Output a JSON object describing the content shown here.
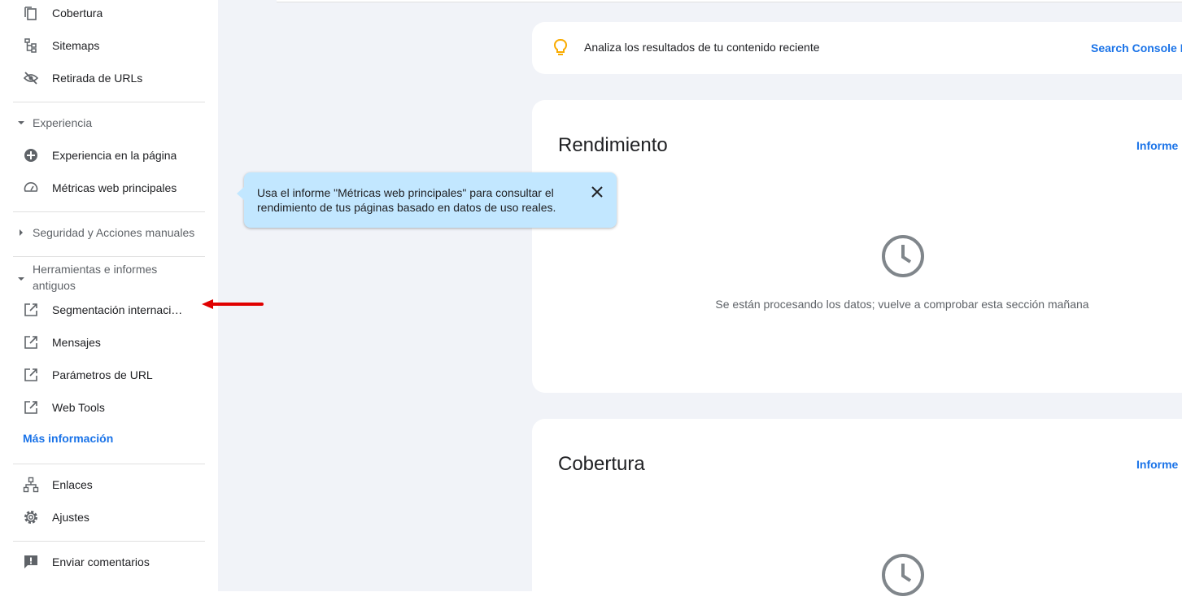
{
  "sidebar": {
    "top_items": [
      {
        "label": "Cobertura",
        "icon": "copy-pages-icon"
      },
      {
        "label": "Sitemaps",
        "icon": "sitemap-icon"
      },
      {
        "label": "Retirada de URLs",
        "icon": "eye-off-icon"
      }
    ],
    "experience": {
      "header": "Experiencia",
      "items": [
        {
          "label": "Experiencia en la página",
          "icon": "plus-circle-icon"
        },
        {
          "label": "Métricas web principales",
          "icon": "gauge-icon"
        }
      ]
    },
    "security": {
      "header": "Seguridad y Acciones manuales"
    },
    "legacy": {
      "header_line1": "Herramientas e informes",
      "header_line2": "antiguos",
      "items": [
        {
          "label": "Segmentación internaci…",
          "icon": "external-link-icon"
        },
        {
          "label": "Mensajes",
          "icon": "external-link-icon"
        },
        {
          "label": "Parámetros de URL",
          "icon": "external-link-icon"
        },
        {
          "label": "Web Tools",
          "icon": "external-link-icon"
        }
      ],
      "more_link": "Más información"
    },
    "bottom_items": [
      {
        "label": "Enlaces",
        "icon": "links-tree-icon"
      },
      {
        "label": "Ajustes",
        "icon": "gear-icon"
      }
    ],
    "feedback": {
      "label": "Enviar comentarios",
      "icon": "feedback-icon"
    }
  },
  "tip": {
    "text": "Analiza los resultados de tu contenido reciente",
    "link": "Search Console I",
    "icon": "lightbulb-icon",
    "icon_color": "#f9ab00"
  },
  "performance": {
    "title": "Rendimiento",
    "link": "Informe",
    "message": "Se están procesando los datos; vuelve a comprobar esta sección mañana"
  },
  "coverage": {
    "title": "Cobertura",
    "link": "Informe"
  },
  "tooltip": {
    "line1": "Usa el informe \"Métricas web principales\" para consultar el",
    "line2": "rendimiento de tus páginas basado en datos de uso reales."
  },
  "colors": {
    "accent": "#1a73e8",
    "tooltip_bg": "#c2e7ff",
    "annotation_arrow": "#e00000"
  }
}
